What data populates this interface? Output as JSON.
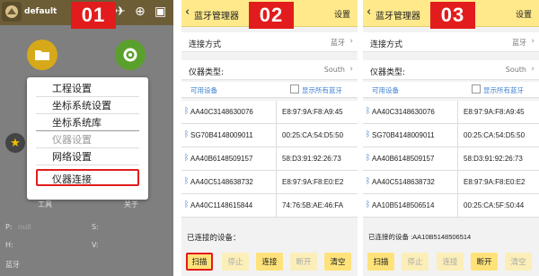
{
  "steps": [
    "01",
    "02",
    "03"
  ],
  "panel1": {
    "project_name": "default",
    "menu_items": [
      "工程设置",
      "坐标系统设置",
      "坐标系统库",
      "仪器设置",
      "网络设置",
      "仪器连接"
    ],
    "footer": {
      "p_label": "P:",
      "p_value": "null",
      "s_label": "S:",
      "h_label": "H:",
      "v_label": "V:",
      "bt_label": "蓝牙",
      "tool_label": "工具",
      "about_label": "关于"
    }
  },
  "panel2": {
    "title": "蓝牙管理器",
    "settings_label": "设置",
    "connection_label": "连接方式",
    "connection_value": "蓝牙",
    "instrument_label": "仪器类型:",
    "instrument_value": "South",
    "available_label": "可用设备",
    "show_all_label": "显示所有蓝牙",
    "devices": [
      {
        "name": "AA40C3148630076",
        "mac": "E8:97:9A:F8:A9:45"
      },
      {
        "name": "SG70B4148009011",
        "mac": "00:25:CA:54:D5:50"
      },
      {
        "name": "AA40B6148509157",
        "mac": "58:D3:91:92:26:73"
      },
      {
        "name": "AA40C5148638732",
        "mac": "E8:97:9A:F8:E0:E2"
      },
      {
        "name": "AA40C1148615844",
        "mac": "74:76:5B:AE:46:FA"
      }
    ],
    "connected_label": "已连接的设备：",
    "buttons": [
      "扫描",
      "停止",
      "连接",
      "断开",
      "清空"
    ]
  },
  "panel3": {
    "title": "蓝牙管理器",
    "settings_label": "设置",
    "connection_label": "连接方式",
    "connection_value": "蓝牙",
    "instrument_label": "仪器类型:",
    "instrument_value": "South",
    "available_label": "可用设备",
    "show_all_label": "显示所有蓝牙",
    "devices": [
      {
        "name": "AA40C3148630076",
        "mac": "E8:97:9A:F8:A9:45"
      },
      {
        "name": "SG70B4148009011",
        "mac": "00:25:CA:54:D5:50"
      },
      {
        "name": "AA40B6148509157",
        "mac": "58:D3:91:92:26:73"
      },
      {
        "name": "AA40C5148638732",
        "mac": "E8:97:9A:F8:E0:E2"
      },
      {
        "name": "AA10B5148506514",
        "mac": "00:25:CA:5F:50:44"
      }
    ],
    "connected_label": "已连接的设备 :AA10B5148506514",
    "buttons": [
      "扫描",
      "停止",
      "连接",
      "断开",
      "清空"
    ]
  },
  "colors": {
    "badge": "#e21c1c",
    "header": "#ffe98a",
    "button": "#ffe37a",
    "link": "#3c7fd1"
  }
}
